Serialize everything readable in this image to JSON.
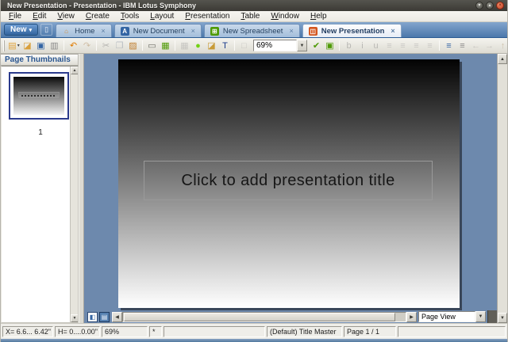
{
  "window": {
    "title": "New Presentation - Presentation - IBM Lotus Symphony",
    "controls": [
      {
        "name": "minimize-button",
        "glyph": "▾"
      },
      {
        "name": "maximize-button",
        "glyph": "▴"
      },
      {
        "name": "close-button",
        "glyph": "×"
      }
    ]
  },
  "menu": {
    "items": [
      {
        "label": "File"
      },
      {
        "label": "Edit"
      },
      {
        "label": "View"
      },
      {
        "label": "Create"
      },
      {
        "label": "Tools"
      },
      {
        "label": "Layout"
      },
      {
        "label": "Presentation"
      },
      {
        "label": "Table"
      },
      {
        "label": "Window"
      },
      {
        "label": "Help"
      }
    ]
  },
  "tab_bar": {
    "new_button": {
      "label": "New",
      "dropdown_glyph": "▾"
    },
    "open_document_button_glyph": "▯",
    "close_glyph": "×",
    "tabs": [
      {
        "label": "Home",
        "icon": "home-icon",
        "glyph": "⌂",
        "icon_bg": "none",
        "icon_fg": "#d8882b",
        "active": false
      },
      {
        "label": "New Document",
        "icon": "document-icon",
        "glyph": "A",
        "icon_bg": "#3465a4",
        "icon_fg": "#ffffff",
        "active": false
      },
      {
        "label": "New Spreadsheet",
        "icon": "spreadsheet-icon",
        "glyph": "⊞",
        "icon_bg": "#4e9a06",
        "icon_fg": "#ffffff",
        "active": false
      },
      {
        "label": "New Presentation",
        "icon": "presentation-icon",
        "glyph": "◫",
        "icon_bg": "#d4561e",
        "icon_fg": "#ffffff",
        "active": true
      }
    ]
  },
  "toolbar": {
    "zoom_value": "69%",
    "items": [
      {
        "type": "icon",
        "name": "new-document-icon",
        "glyph": "▤",
        "color": "#e0a33c",
        "enabled": true,
        "dropdown": true
      },
      {
        "type": "icon",
        "name": "open-icon",
        "glyph": "◪",
        "color": "#d9a03c",
        "enabled": true
      },
      {
        "type": "icon",
        "name": "save-icon",
        "glyph": "▣",
        "color": "#3465a4",
        "enabled": true
      },
      {
        "type": "icon",
        "name": "print-icon",
        "glyph": "▥",
        "color": "#8a8a8a",
        "enabled": true
      },
      {
        "type": "sep"
      },
      {
        "type": "icon",
        "name": "undo-icon",
        "glyph": "↶",
        "color": "#e07b00",
        "enabled": true
      },
      {
        "type": "icon",
        "name": "redo-icon",
        "glyph": "↷",
        "color": "#e07b00",
        "enabled": false
      },
      {
        "type": "sep"
      },
      {
        "type": "icon",
        "name": "cut-icon",
        "glyph": "✂",
        "color": "#666666",
        "enabled": false
      },
      {
        "type": "icon",
        "name": "copy-icon",
        "glyph": "❐",
        "color": "#5a7fb5",
        "enabled": false
      },
      {
        "type": "icon",
        "name": "paste-icon",
        "glyph": "▨",
        "color": "#c07f30",
        "enabled": true
      },
      {
        "type": "sep"
      },
      {
        "type": "icon",
        "name": "frame-icon",
        "glyph": "▭",
        "color": "#6f6f67",
        "enabled": true
      },
      {
        "type": "icon",
        "name": "insert-image-icon",
        "glyph": "▦",
        "color": "#4e9a06",
        "enabled": true
      },
      {
        "type": "sep"
      },
      {
        "type": "icon",
        "name": "table-icon",
        "glyph": "▦",
        "color": "#999999",
        "enabled": false
      },
      {
        "type": "icon",
        "name": "shape-icon",
        "glyph": "●",
        "color": "#73d216",
        "enabled": true
      },
      {
        "type": "icon",
        "name": "gallery-icon",
        "glyph": "◪",
        "color": "#c89b37",
        "enabled": true
      },
      {
        "type": "icon",
        "name": "text-box-icon",
        "glyph": "T",
        "color": "#1a3c8c",
        "enabled": true
      },
      {
        "type": "sep"
      },
      {
        "type": "icon",
        "name": "zoom-icon",
        "glyph": "□",
        "color": "#999999",
        "enabled": false
      },
      {
        "type": "combo",
        "name": "zoom-level-combobox"
      },
      {
        "type": "icon",
        "name": "spellcheck-icon",
        "glyph": "✔",
        "color": "#4e9a06",
        "enabled": true
      },
      {
        "type": "icon",
        "name": "screen-show-icon",
        "glyph": "▣",
        "color": "#4e9a06",
        "enabled": true
      },
      {
        "type": "sep"
      },
      {
        "type": "icon",
        "name": "bold-icon",
        "glyph": "b",
        "color": "#777777",
        "enabled": false
      },
      {
        "type": "icon",
        "name": "italic-icon",
        "glyph": "i",
        "color": "#777777",
        "enabled": false
      },
      {
        "type": "icon",
        "name": "underline-icon",
        "glyph": "u",
        "color": "#777777",
        "enabled": false
      },
      {
        "type": "icon",
        "name": "align-left-icon",
        "glyph": "≡",
        "color": "#9a9a9a",
        "enabled": false
      },
      {
        "type": "icon",
        "name": "align-center-icon",
        "glyph": "≡",
        "color": "#9a9a9a",
        "enabled": false
      },
      {
        "type": "icon",
        "name": "align-right-icon",
        "glyph": "≡",
        "color": "#9a9a9a",
        "enabled": false
      },
      {
        "type": "icon",
        "name": "align-justify-icon",
        "glyph": "≡",
        "color": "#9a9a9a",
        "enabled": false
      },
      {
        "type": "sep"
      },
      {
        "type": "icon",
        "name": "bullet-list-icon",
        "glyph": "≡",
        "color": "#3465a4",
        "enabled": true
      },
      {
        "type": "icon",
        "name": "numbered-list-icon",
        "glyph": "≡",
        "color": "#888888",
        "enabled": true
      },
      {
        "type": "icon",
        "name": "promote-icon",
        "glyph": "←",
        "color": "#999999",
        "enabled": false
      },
      {
        "type": "icon",
        "name": "demote-icon",
        "glyph": "→",
        "color": "#999999",
        "enabled": false
      },
      {
        "type": "icon",
        "name": "move-up-icon",
        "glyph": "↑",
        "color": "#c8881e",
        "enabled": false
      },
      {
        "type": "icon",
        "name": "move-down-icon",
        "glyph": "↓",
        "color": "#c8881e",
        "enabled": false
      },
      {
        "type": "sep"
      },
      {
        "type": "icon",
        "name": "properties-icon",
        "glyph": "⚙",
        "color": "#8a8a84",
        "enabled": false
      },
      {
        "type": "icon",
        "name": "toolbar-overflow-icon",
        "glyph": "=",
        "color": "#666666",
        "enabled": true
      }
    ]
  },
  "sidebar": {
    "title": "Page Thumbnails",
    "thumbnails": [
      {
        "number": "1",
        "selected": true
      }
    ]
  },
  "slide": {
    "title_placeholder": "Click to add presentation title"
  },
  "bottom_bar": {
    "view_selector_value": "Page View"
  },
  "status_bar": {
    "fields": [
      {
        "name": "cursor-position",
        "text": "X= 6.6... 6.42\""
      },
      {
        "name": "object-size",
        "text": "H= 0....0.00\""
      },
      {
        "name": "zoom-level",
        "text": "69%"
      },
      {
        "name": "modified-flag",
        "text": "*"
      },
      {
        "name": "status-spacer",
        "text": ""
      },
      {
        "name": "slide-master",
        "text": "(Default) Title Master"
      },
      {
        "name": "page-number",
        "text": "Page 1 / 1"
      }
    ]
  }
}
